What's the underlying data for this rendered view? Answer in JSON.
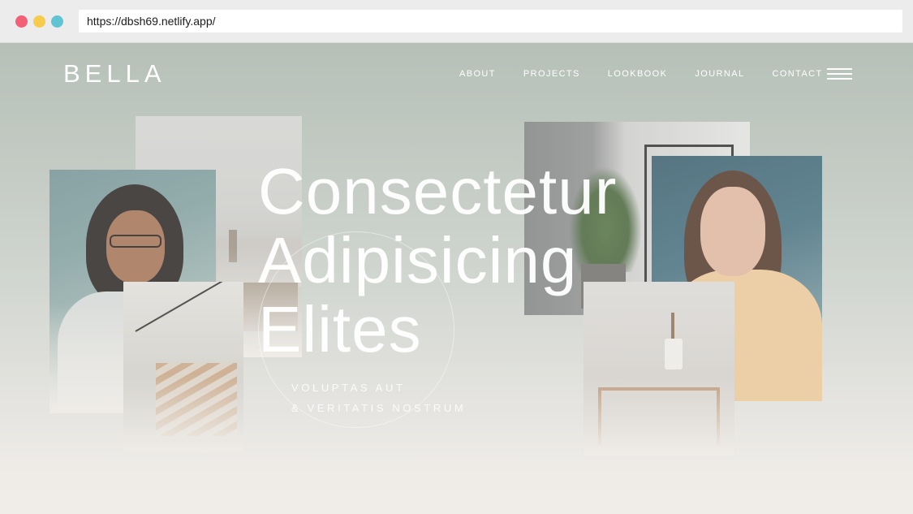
{
  "browser": {
    "url": "https://dbsh69.netlify.app/"
  },
  "site": {
    "logo": "BELLA",
    "nav": [
      {
        "label": "ABOUT"
      },
      {
        "label": "PROJECTS"
      },
      {
        "label": "LOOKBOOK"
      },
      {
        "label": "JOURNAL"
      },
      {
        "label": "CONTACT"
      }
    ],
    "menu_icon": "hamburger-menu-icon",
    "hero": {
      "title_lines": [
        "Consectetur",
        "Adipisicing",
        "Elites"
      ],
      "subtitle_lines": [
        "VOLUPTAS AUT",
        "& VERITATIS NOSTRUM"
      ]
    }
  },
  "colors": {
    "browser_red": "#f25f76",
    "browser_yellow": "#f7cc4d",
    "browser_teal": "#5fc5d2",
    "hero_text": "#ffffff",
    "background_top": "#a9b7ad",
    "background_bottom": "#f4f0ec"
  }
}
